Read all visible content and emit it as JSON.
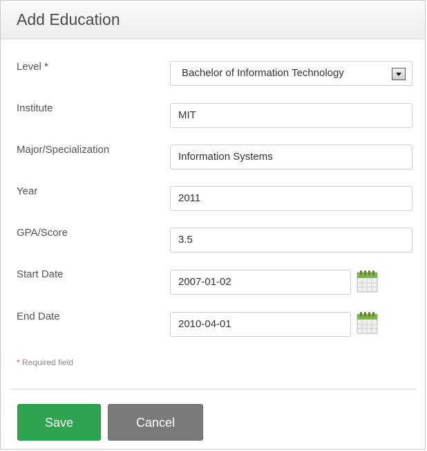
{
  "dialog": {
    "title": "Add Education"
  },
  "form": {
    "level": {
      "label": "Level",
      "required_mark": "*",
      "value": "Bachelor of Information Technology"
    },
    "institute": {
      "label": "Institute",
      "value": "MIT"
    },
    "major": {
      "label": "Major/Specialization",
      "value": "Information Systems"
    },
    "year": {
      "label": "Year",
      "value": "2011"
    },
    "gpa": {
      "label": "GPA/Score",
      "value": "3.5"
    },
    "start_date": {
      "label": "Start Date",
      "value": "2007-01-02"
    },
    "end_date": {
      "label": "End Date",
      "value": "2010-04-01"
    }
  },
  "required_note": {
    "star": "*",
    "text": " Required field"
  },
  "buttons": {
    "save_label": "Save",
    "cancel_label": "Cancel"
  },
  "icons": {
    "calendar": "calendar-icon",
    "dropdown": "chevron-down-icon"
  },
  "colors": {
    "save": "#2ea44f",
    "cancel": "#7a7a7a",
    "calendar_green": "#7fb24a"
  }
}
